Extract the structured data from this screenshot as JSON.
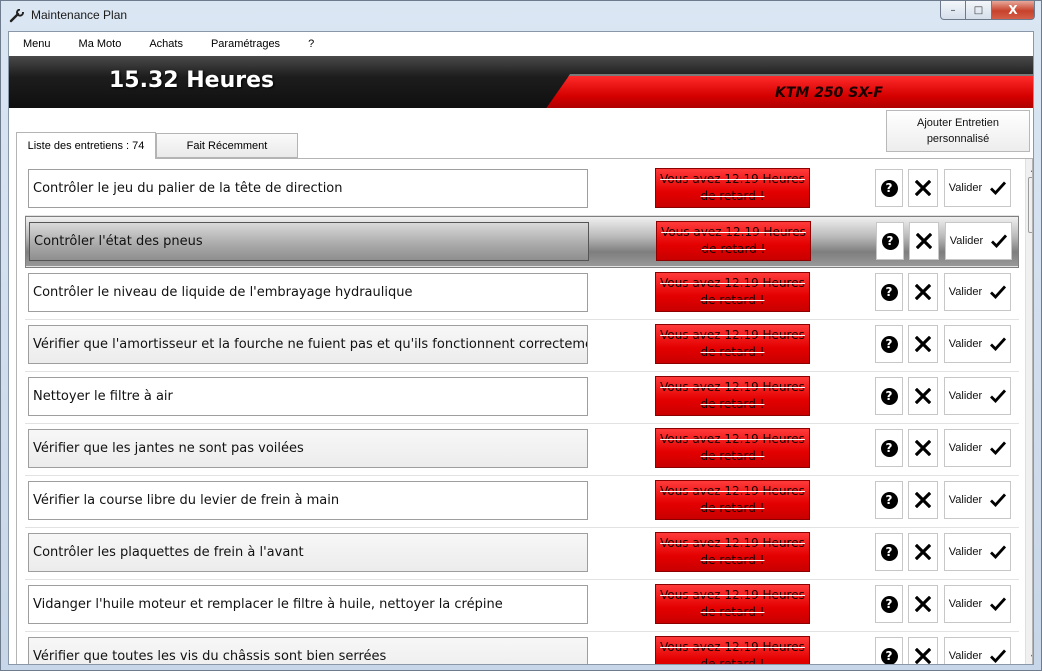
{
  "window": {
    "title": "Maintenance Plan",
    "minimize": "–",
    "maximize": "□",
    "close": "X"
  },
  "menu": [
    "Menu",
    "Ma Moto",
    "Achats",
    "Paramétrages",
    "?"
  ],
  "banner": {
    "hours": "15.32 Heures",
    "model": "KTM 250 SX-F"
  },
  "tabs": {
    "list_label": "Liste des entretiens : 74",
    "recent_label": "Fait Récemment"
  },
  "add_button": {
    "line1": "Ajouter Entretien",
    "line2": "personnalisé"
  },
  "late": {
    "line1": "Vous avez 12.19 Heures",
    "line2": "de retard !"
  },
  "validate_label": "Valider",
  "help_glyph": "?",
  "colors": {
    "accent_red": "#e00000",
    "banner_dark": "#1d1d1d"
  },
  "tasks": [
    "Contrôler le jeu du palier de la tête de direction",
    "Contrôler l'état des pneus",
    "Contrôler le niveau de liquide de l'embrayage hydraulique",
    "Vérifier que l'amortisseur et la fourche ne fuient pas et qu'ils fonctionnent correctement",
    "Nettoyer le filtre à air",
    "Vérifier que les jantes ne sont pas voilées",
    "Vérifier la course libre du levier de frein à main",
    "Contrôler les plaquettes de frein à l'avant",
    "Vidanger l'huile moteur et remplacer le filtre à huile, nettoyer la crépine",
    "Vérifier que toutes les vis du châssis sont bien serrées"
  ],
  "selected_index": 1
}
